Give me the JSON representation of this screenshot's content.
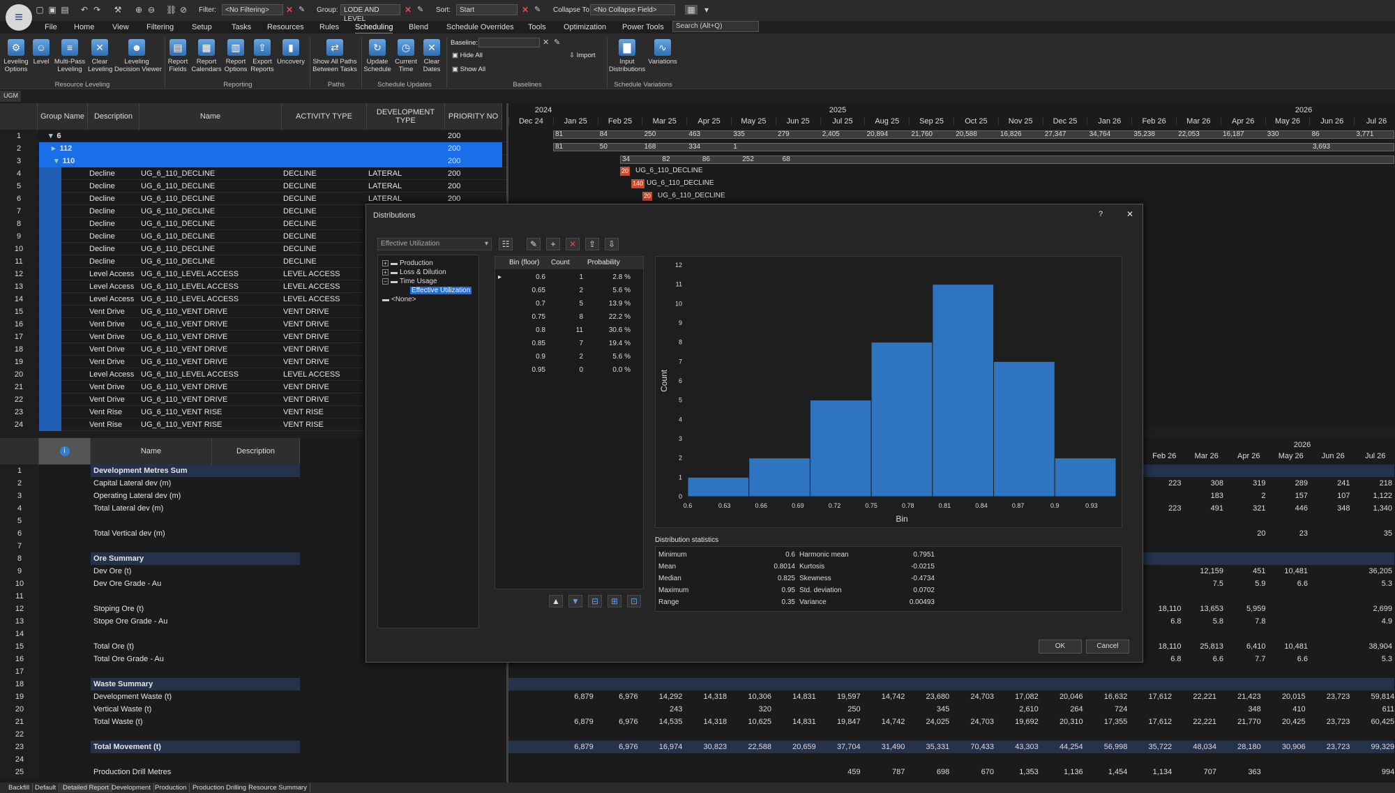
{
  "toolbar": {
    "filter_label": "Filter:",
    "filter_value": "<No Filtering>",
    "group_label": "Group:",
    "group_value": "LODE AND LEVEL",
    "sort_label": "Sort:",
    "sort_value": "Start",
    "collapse_label": "Collapse To:",
    "collapse_value": "<No Collapse Field>",
    "search_placeholder": "Search (Alt+Q)"
  },
  "tabs": [
    "File",
    "Home",
    "View",
    "Filtering",
    "Setup",
    "Tasks",
    "Resources",
    "Rules",
    "Scheduling",
    "Blend",
    "Schedule Overrides",
    "Tools",
    "Optimization",
    "Power Tools"
  ],
  "active_tab": "Scheduling",
  "ribbon": {
    "buttons": [
      {
        "label": "Leveling\nOptions",
        "icon": "leveling-options-icon"
      },
      {
        "label": "Level",
        "icon": "level-icon"
      },
      {
        "label": "Multi-Pass\nLeveling",
        "icon": "multi-pass-icon"
      },
      {
        "label": "Clear\nLeveling",
        "icon": "clear-leveling-icon"
      },
      {
        "label": "Leveling\nDecision Viewer",
        "icon": "decision-viewer-icon"
      },
      {
        "label": "Report\nFields",
        "icon": "report-fields-icon"
      },
      {
        "label": "Report\nCalendars",
        "icon": "report-calendars-icon"
      },
      {
        "label": "Report\nOptions",
        "icon": "report-options-icon"
      },
      {
        "label": "Export\nReports",
        "icon": "export-reports-icon"
      },
      {
        "label": "Uncovery",
        "icon": "uncovery-icon"
      },
      {
        "label": "Show All Paths\nBetween Tasks",
        "icon": "paths-icon"
      },
      {
        "label": "Update\nSchedule",
        "icon": "update-schedule-icon"
      },
      {
        "label": "Current\nTime",
        "icon": "clock-icon"
      },
      {
        "label": "Clear\nDates",
        "icon": "clear-dates-icon"
      },
      {
        "label": "Input\nDistributions",
        "icon": "distributions-icon"
      },
      {
        "label": "Variations",
        "icon": "variations-icon"
      }
    ],
    "groups": [
      "Resource Leveling",
      "Reporting",
      "Paths",
      "Schedule Updates",
      "Baselines",
      "Schedule Variations"
    ],
    "baseline_label": "Baseline:",
    "hide_all": "Hide All",
    "show_all": "Show All",
    "import": "Import"
  },
  "doc_tab": "UGM",
  "grid": {
    "headers": [
      "Group Name",
      "Description",
      "Name",
      "ACTIVITY TYPE",
      "DEVELOPMENT TYPE",
      "PRIORITY NO"
    ],
    "group_rows": [
      {
        "n": "1",
        "label": "6",
        "priority": "200"
      },
      {
        "n": "2",
        "label": "112",
        "priority": "200"
      },
      {
        "n": "3",
        "label": "110",
        "priority": "200"
      }
    ],
    "rows": [
      {
        "n": "4",
        "desc": "Decline",
        "name": "UG_6_110_DECLINE",
        "type": "DECLINE",
        "dev": "LATERAL",
        "pr": "200"
      },
      {
        "n": "5",
        "desc": "Decline",
        "name": "UG_6_110_DECLINE",
        "type": "DECLINE",
        "dev": "LATERAL",
        "pr": "200"
      },
      {
        "n": "6",
        "desc": "Decline",
        "name": "UG_6_110_DECLINE",
        "type": "DECLINE",
        "dev": "LATERAL",
        "pr": "200"
      },
      {
        "n": "7",
        "desc": "Decline",
        "name": "UG_6_110_DECLINE",
        "type": "DECLINE",
        "dev": "",
        "pr": ""
      },
      {
        "n": "8",
        "desc": "Decline",
        "name": "UG_6_110_DECLINE",
        "type": "DECLINE",
        "dev": "",
        "pr": ""
      },
      {
        "n": "9",
        "desc": "Decline",
        "name": "UG_6_110_DECLINE",
        "type": "DECLINE",
        "dev": "",
        "pr": ""
      },
      {
        "n": "10",
        "desc": "Decline",
        "name": "UG_6_110_DECLINE",
        "type": "DECLINE",
        "dev": "",
        "pr": ""
      },
      {
        "n": "11",
        "desc": "Decline",
        "name": "UG_6_110_DECLINE",
        "type": "DECLINE",
        "dev": "",
        "pr": ""
      },
      {
        "n": "12",
        "desc": "Level Access",
        "name": "UG_6_110_LEVEL ACCESS",
        "type": "LEVEL ACCESS",
        "dev": "",
        "pr": ""
      },
      {
        "n": "13",
        "desc": "Level Access",
        "name": "UG_6_110_LEVEL ACCESS",
        "type": "LEVEL ACCESS",
        "dev": "",
        "pr": ""
      },
      {
        "n": "14",
        "desc": "Level Access",
        "name": "UG_6_110_LEVEL ACCESS",
        "type": "LEVEL ACCESS",
        "dev": "",
        "pr": ""
      },
      {
        "n": "15",
        "desc": "Vent Drive",
        "name": "UG_6_110_VENT DRIVE",
        "type": "VENT DRIVE",
        "dev": "",
        "pr": ""
      },
      {
        "n": "16",
        "desc": "Vent Drive",
        "name": "UG_6_110_VENT DRIVE",
        "type": "VENT DRIVE",
        "dev": "",
        "pr": ""
      },
      {
        "n": "17",
        "desc": "Vent Drive",
        "name": "UG_6_110_VENT DRIVE",
        "type": "VENT DRIVE",
        "dev": "",
        "pr": ""
      },
      {
        "n": "18",
        "desc": "Vent Drive",
        "name": "UG_6_110_VENT DRIVE",
        "type": "VENT DRIVE",
        "dev": "",
        "pr": ""
      },
      {
        "n": "19",
        "desc": "Vent Drive",
        "name": "UG_6_110_VENT DRIVE",
        "type": "VENT DRIVE",
        "dev": "",
        "pr": ""
      },
      {
        "n": "20",
        "desc": "Level Access",
        "name": "UG_6_110_LEVEL ACCESS",
        "type": "LEVEL ACCESS",
        "dev": "",
        "pr": ""
      },
      {
        "n": "21",
        "desc": "Vent Drive",
        "name": "UG_6_110_VENT DRIVE",
        "type": "VENT DRIVE",
        "dev": "",
        "pr": ""
      },
      {
        "n": "22",
        "desc": "Vent Drive",
        "name": "UG_6_110_VENT DRIVE",
        "type": "VENT DRIVE",
        "dev": "",
        "pr": ""
      },
      {
        "n": "23",
        "desc": "Vent Rise",
        "name": "UG_6_110_VENT RISE",
        "type": "VENT RISE",
        "dev": "",
        "pr": ""
      },
      {
        "n": "24",
        "desc": "Vent Rise",
        "name": "UG_6_110_VENT RISE",
        "type": "VENT RISE",
        "dev": "",
        "pr": ""
      }
    ]
  },
  "gantt": {
    "years": [
      "2024",
      "2025",
      "2026"
    ],
    "months": [
      "Dec 24",
      "Jan 25",
      "Feb 25",
      "Mar 25",
      "Apr 25",
      "May 25",
      "Jun 25",
      "Jul 25",
      "Aug 25",
      "Sep 25",
      "Oct 25",
      "Nov 25",
      "Dec 25",
      "Jan 26",
      "Feb 26",
      "Mar 26",
      "Apr 26",
      "May 26",
      "Jun 26",
      "Jul 26"
    ],
    "row1": [
      "81",
      "84",
      "250",
      "463",
      "335",
      "279",
      "2,405",
      "20,894",
      "21,760",
      "20,588",
      "16,826",
      "27,347",
      "34,764",
      "35,238",
      "22,053",
      "16,187",
      "330",
      "86",
      "3,771"
    ],
    "row2": [
      "81",
      "50",
      "168",
      "334",
      "1"
    ],
    "row2_end": "3,693",
    "row3": [
      "34",
      "82",
      "86",
      "252",
      "68"
    ],
    "tasks": [
      {
        "badge": "20",
        "label": "UG_6_110_DECLINE"
      },
      {
        "badge": "140",
        "label": "UG_6_110_DECLINE"
      },
      {
        "badge": "20",
        "label": "UG_6_110_DECLINE"
      }
    ]
  },
  "report": {
    "headers": [
      "Name",
      "Description"
    ],
    "rows": [
      {
        "n": "1",
        "name": "Development Metres Sum",
        "sum": true
      },
      {
        "n": "2",
        "name": "Capital Lateral dev (m)"
      },
      {
        "n": "3",
        "name": "Operating Lateral dev (m)"
      },
      {
        "n": "4",
        "name": "Total Lateral dev (m)"
      },
      {
        "n": "5",
        "name": ""
      },
      {
        "n": "6",
        "name": "Total Vertical dev (m)"
      },
      {
        "n": "7",
        "name": ""
      },
      {
        "n": "8",
        "name": "Ore Summary",
        "sum": true
      },
      {
        "n": "9",
        "name": "Dev Ore (t)"
      },
      {
        "n": "10",
        "name": "Dev Ore Grade - Au"
      },
      {
        "n": "11",
        "name": ""
      },
      {
        "n": "12",
        "name": "Stoping Ore (t)"
      },
      {
        "n": "13",
        "name": "Stope Ore Grade - Au"
      },
      {
        "n": "14",
        "name": ""
      },
      {
        "n": "15",
        "name": "Total Ore (t)"
      },
      {
        "n": "16",
        "name": "Total Ore Grade - Au"
      },
      {
        "n": "17",
        "name": ""
      },
      {
        "n": "18",
        "name": "Waste Summary",
        "sum": true
      },
      {
        "n": "19",
        "name": "Development Waste (t)"
      },
      {
        "n": "20",
        "name": "Vertical Waste (t)"
      },
      {
        "n": "21",
        "name": "Total Waste (t)"
      },
      {
        "n": "22",
        "name": ""
      },
      {
        "n": "23",
        "name": "Total Movement (t)",
        "sum": true
      },
      {
        "n": "24",
        "name": ""
      },
      {
        "n": "25",
        "name": "Production Drill Metres"
      }
    ],
    "right_year": "2026",
    "right_months": [
      "Feb 26",
      "Mar 26",
      "Apr 26",
      "May 26",
      "Jun 26",
      "Jul 26"
    ],
    "right_values": {
      "2": [
        "223",
        "308",
        "319",
        "289",
        "241",
        "218"
      ],
      "3": [
        "",
        "183",
        "2",
        "157",
        "107",
        "1,122"
      ],
      "4": [
        "223",
        "491",
        "321",
        "446",
        "348",
        "1,340"
      ],
      "6": [
        "",
        "",
        "20",
        "23",
        "",
        "35"
      ],
      "9": [
        "",
        "12,159",
        "451",
        "10,481",
        "",
        "36,205"
      ],
      "10": [
        "",
        "7.5",
        "5.9",
        "6.6",
        "",
        "5.3"
      ],
      "12": [
        "18,110",
        "13,653",
        "5,959",
        "",
        "",
        "2,699"
      ],
      "13": [
        "6.8",
        "5.8",
        "7.8",
        "",
        "",
        "4.9"
      ],
      "15": [
        "18,110",
        "25,813",
        "6,410",
        "10,481",
        "",
        "38,904"
      ],
      "16": [
        "6.8",
        "6.6",
        "7.7",
        "6.6",
        "",
        "5.3"
      ]
    },
    "bottom_months": [
      "Jan 25",
      "Feb 25",
      "Mar 25",
      "Apr 25",
      "May 25",
      "Jun 25",
      "Jul 25",
      "Aug 25",
      "Sep 25",
      "Oct 25",
      "Nov 25",
      "Dec 25",
      "Jan 26",
      "Feb 26",
      "Mar 26",
      "Apr 26",
      "May 26",
      "Jun 26",
      "Jul 26"
    ],
    "bottom_values": {
      "19": [
        "6,879",
        "6,976",
        "14,292",
        "14,318",
        "10,306",
        "14,831",
        "19,597",
        "14,742",
        "23,680",
        "24,703",
        "17,082",
        "20,046",
        "16,632",
        "17,612",
        "22,221",
        "21,423",
        "20,015",
        "23,723",
        "59,814"
      ],
      "20": [
        "",
        "",
        "243",
        "",
        "320",
        "",
        "250",
        "",
        "345",
        "",
        "2,610",
        "264",
        "724",
        "",
        "",
        "348",
        "410",
        "",
        "611"
      ],
      "21": [
        "6,879",
        "6,976",
        "14,535",
        "14,318",
        "10,625",
        "14,831",
        "19,847",
        "14,742",
        "24,025",
        "24,703",
        "19,692",
        "20,310",
        "17,355",
        "17,612",
        "22,221",
        "21,770",
        "20,425",
        "23,723",
        "60,425"
      ],
      "23": [
        "6,879",
        "6,976",
        "16,974",
        "30,823",
        "22,588",
        "20,659",
        "37,704",
        "31,490",
        "35,331",
        "70,433",
        "43,303",
        "44,254",
        "56,998",
        "35,722",
        "48,034",
        "28,180",
        "30,906",
        "23,723",
        "99,329"
      ],
      "25": [
        "",
        "",
        "",
        "",
        "",
        "",
        "459",
        "787",
        "698",
        "670",
        "1,353",
        "1,136",
        "1,454",
        "1,134",
        "707",
        "363",
        "",
        "",
        "994"
      ]
    }
  },
  "bottom_tabs": [
    "Backfill",
    "Default",
    "Detailed Report",
    "Development",
    "Production",
    "Production Drilling",
    "Resource Summary"
  ],
  "dialog": {
    "title": "Distributions",
    "help": "?",
    "close": "✕",
    "selector": "Effective Utilization",
    "tree": [
      {
        "label": "Production",
        "level": 0,
        "expand": "+"
      },
      {
        "label": "Loss & Dilution",
        "level": 0,
        "expand": "+"
      },
      {
        "label": "Time Usage",
        "level": 0,
        "expand": "−"
      },
      {
        "label": "Effective Utilization",
        "level": 1,
        "selected": true
      },
      {
        "label": "<None>",
        "level": 0
      }
    ],
    "table_headers": [
      "Bin (floor)",
      "Count",
      "Probability"
    ],
    "table_rows": [
      {
        "bin": "0.6",
        "count": "1",
        "prob": "2.8 %"
      },
      {
        "bin": "0.65",
        "count": "2",
        "prob": "5.6 %"
      },
      {
        "bin": "0.7",
        "count": "5",
        "prob": "13.9 %"
      },
      {
        "bin": "0.75",
        "count": "8",
        "prob": "22.2 %"
      },
      {
        "bin": "0.8",
        "count": "11",
        "prob": "30.6 %"
      },
      {
        "bin": "0.85",
        "count": "7",
        "prob": "19.4 %"
      },
      {
        "bin": "0.9",
        "count": "2",
        "prob": "5.6 %"
      },
      {
        "bin": "0.95",
        "count": "0",
        "prob": "0.0 %"
      }
    ],
    "stats_title": "Distribution statistics",
    "stats_left": [
      {
        "k": "Minimum",
        "v": "0.6"
      },
      {
        "k": "Mean",
        "v": "0.8014"
      },
      {
        "k": "Median",
        "v": "0.825"
      },
      {
        "k": "Maximum",
        "v": "0.95"
      },
      {
        "k": "Range",
        "v": "0.35"
      }
    ],
    "stats_right": [
      {
        "k": "Harmonic mean",
        "v": "0.7951"
      },
      {
        "k": "Kurtosis",
        "v": "-0.0215"
      },
      {
        "k": "Skewness",
        "v": "-0.4734"
      },
      {
        "k": "Std. deviation",
        "v": "0.0702"
      },
      {
        "k": "Variance",
        "v": "0.00493"
      }
    ],
    "ok": "OK",
    "cancel": "Cancel"
  },
  "chart_data": {
    "type": "bar",
    "xlabel": "Bin",
    "ylabel": "Count",
    "bin_edges": [
      0.6,
      0.65,
      0.7,
      0.75,
      0.8,
      0.85,
      0.9,
      0.95
    ],
    "values": [
      1,
      2,
      5,
      8,
      11,
      7,
      2
    ],
    "x_ticks": [
      "0.6",
      "0.63",
      "0.66",
      "0.69",
      "0.72",
      "0.75",
      "0.78",
      "0.81",
      "0.84",
      "0.87",
      "0.9",
      "0.93"
    ],
    "y_ticks": [
      "0",
      "1",
      "2",
      "3",
      "4",
      "5",
      "6",
      "7",
      "8",
      "9",
      "10",
      "11",
      "12"
    ],
    "xlim": [
      0.6,
      0.95
    ],
    "ylim": [
      0,
      12
    ],
    "bar_color": "#2f74c0"
  }
}
